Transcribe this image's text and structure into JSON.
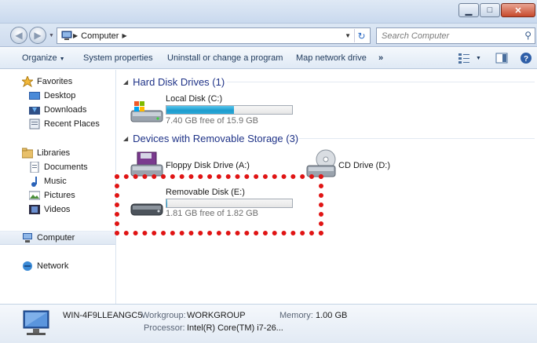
{
  "window": {
    "minimize_glyph": "▁",
    "maximize_glyph": "□",
    "close_glyph": "✕"
  },
  "address": {
    "crumbs": [
      "Computer"
    ],
    "search_placeholder": "Search Computer"
  },
  "toolbar": {
    "organize": "Organize",
    "system_properties": "System properties",
    "uninstall": "Uninstall or change a program",
    "map_network": "Map network drive",
    "more": "»"
  },
  "nav": {
    "favorites": "Favorites",
    "desktop": "Desktop",
    "downloads": "Downloads",
    "recent_places": "Recent Places",
    "libraries": "Libraries",
    "documents": "Documents",
    "music": "Music",
    "pictures": "Pictures",
    "videos": "Videos",
    "computer": "Computer",
    "network": "Network"
  },
  "groups": {
    "hdd": "Hard Disk Drives (1)",
    "removable": "Devices with Removable Storage (3)"
  },
  "drives": {
    "c": {
      "name": "Local Disk (C:)",
      "free": "7.40 GB free of 15.9 GB",
      "used_fraction": 0.535
    },
    "a": {
      "name": "Floppy Disk Drive (A:)"
    },
    "d": {
      "name": "CD Drive (D:)"
    },
    "e": {
      "name": "Removable Disk (E:)",
      "free": "1.81 GB free of 1.82 GB",
      "used_fraction": 0.005
    }
  },
  "details": {
    "computer_name": "WIN-4F9LLEANGC5",
    "workgroup_label": "Workgroup:",
    "workgroup": "WORKGROUP",
    "memory_label": "Memory:",
    "memory": "1.00 GB",
    "processor_label": "Processor:",
    "processor": "Intel(R) Core(TM) i7-26..."
  },
  "colors": {
    "highlight": "#e01414",
    "bar_fill": "#26a8d8",
    "group_heading": "#1e3287"
  }
}
